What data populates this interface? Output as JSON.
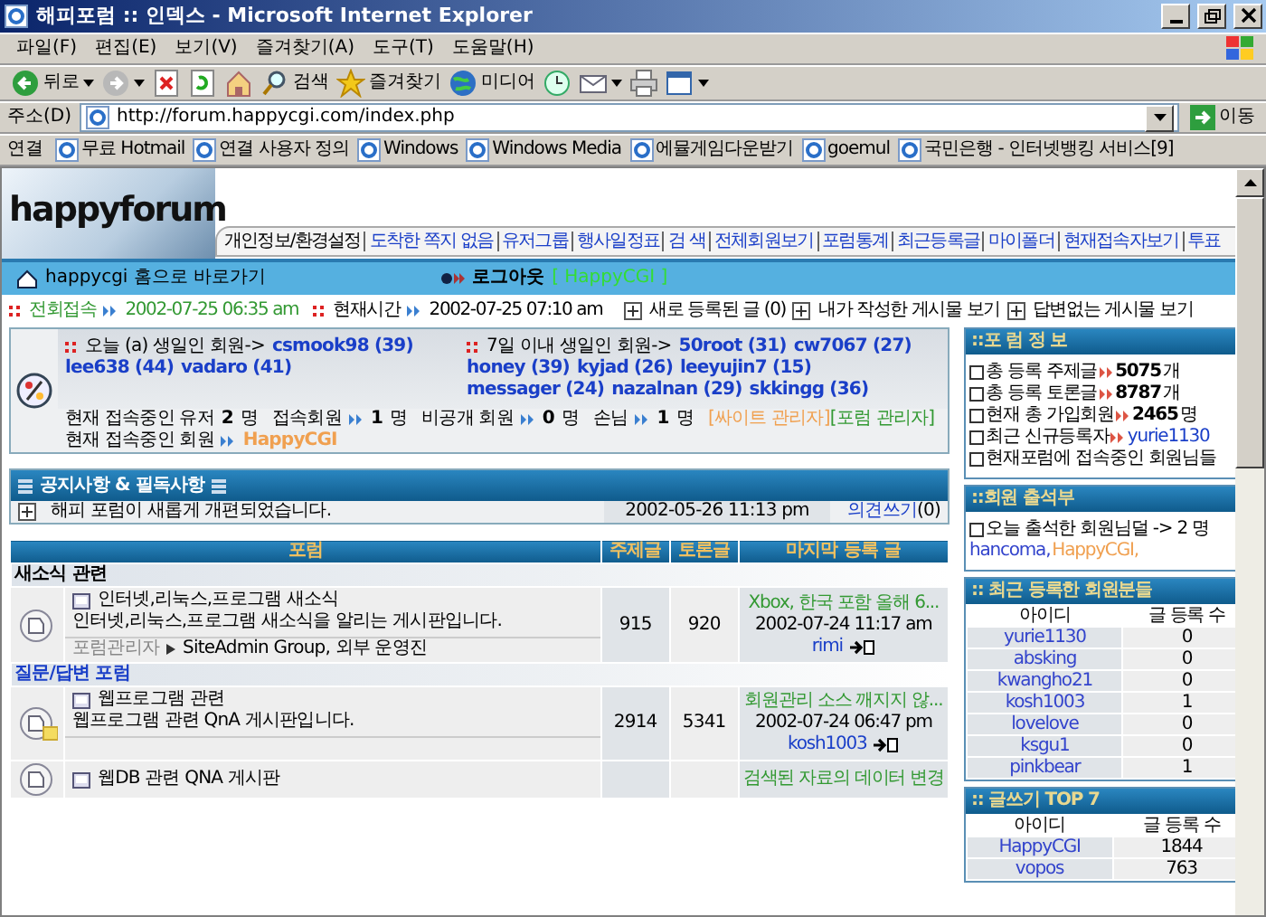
{
  "window": {
    "title": "해피포럼 :: 인덱스 - Microsoft Internet Explorer"
  },
  "menu": [
    "파일(F)",
    "편집(E)",
    "보기(V)",
    "즐겨찾기(A)",
    "도구(T)",
    "도움말(H)"
  ],
  "toolbar": [
    {
      "kind": "back",
      "label": "뒤로",
      "dropdown": true
    },
    {
      "kind": "forward",
      "dropdown": true
    },
    {
      "kind": "stop",
      "dropdown": false
    },
    {
      "kind": "refresh",
      "dropdown": false
    },
    {
      "kind": "home",
      "dropdown": false
    },
    {
      "kind": "search",
      "label": "검색",
      "dropdown": false
    },
    {
      "kind": "favorites",
      "label": "즐겨찾기",
      "dropdown": false
    },
    {
      "kind": "media",
      "label": "미디어",
      "dropdown": false
    },
    {
      "kind": "history",
      "dropdown": false
    },
    {
      "kind": "mail",
      "dropdown": true
    },
    {
      "kind": "print",
      "dropdown": false
    },
    {
      "kind": "edit",
      "dropdown": true
    }
  ],
  "address": {
    "label": "주소(D)",
    "url": "http://forum.happycgi.com/index.php",
    "go": "이동"
  },
  "links": {
    "label": "연결",
    "items": [
      "무료 Hotmail",
      "연결 사용자 정의",
      "Windows",
      "Windows Media",
      "에뮬게임다운받기",
      "goemul",
      "국민은행 - 인터넷뱅킹 서비스[9]"
    ]
  },
  "site": {
    "logo": "happyforum",
    "nav": [
      "개인정보/환경설정",
      "도착한 쪽지 없음",
      "유저그룹",
      "행사일정표",
      "검 색",
      "전체회원보기",
      "포럼통계",
      "최근등록글",
      "마이폴더",
      "현재접속자보기",
      "투표"
    ],
    "bar": {
      "home_link": "happycgi 홈으로 바로가기",
      "logout": "로그아웃",
      "user": "[ HappyCGI ]"
    }
  },
  "info": {
    "last_visit_label": "전회접속",
    "last_visit": "2002-07-25 06:35 am",
    "now_label": "현재시간",
    "now": "2002-07-25 07:10 am",
    "links": [
      "새로 등록된 글 (0)",
      "내가 작성한 게시물 보기",
      "답변없는 게시물 보기"
    ]
  },
  "birthday": {
    "today_label": "오늘 (a) 생일인 회원->",
    "today_members": [
      "csmook98 (39)",
      "lee638 (44)",
      "vadaro (41)"
    ],
    "week_label": "7일 이내 생일인 회원->",
    "week_members": [
      "50root (31)",
      "cw7067 (27)",
      "honey (39)",
      "kyjad (26)",
      "leeyujin7 (15)",
      "messager (24)",
      "nazalnan (29)",
      "skkingg (36)"
    ]
  },
  "online": {
    "stats": [
      {
        "label": "현재 접속중인 유저",
        "value": "2",
        "unit": "명",
        "arrow": false
      },
      {
        "label": "접속회원",
        "value": "1",
        "unit": "명",
        "arrow": true
      },
      {
        "label": "비공개 회원",
        "value": "0",
        "unit": "명",
        "arrow": true
      },
      {
        "label": "손님",
        "value": "1",
        "unit": "명",
        "arrow": true
      }
    ],
    "legend": [
      {
        "label": "[싸이트 관리자]",
        "color": "#f0a050"
      },
      {
        "label": "[포럼 관리자]",
        "color": "#339933"
      }
    ],
    "members_label": "현재 접속중인 회원",
    "members": [
      {
        "name": "HappyCGI",
        "color": "#f0a050"
      }
    ]
  },
  "notice": {
    "title": "공지사항 & 필독사항",
    "items": [
      {
        "text": "해피 포럼이 새롭게 개편되었습니다.",
        "date": "2002-05-26 11:13 pm",
        "comment": "의견쓰기",
        "count": "(0)"
      }
    ]
  },
  "forums": {
    "columns": [
      "포럼",
      "주제글",
      "토론글",
      "마지막 등록 글"
    ],
    "sections": [
      {
        "title": "새소식 관련",
        "color": "#000000",
        "forums": [
          {
            "title": "인터넷,리눅스,프로그램 새소식",
            "desc": "인터넷,리눅스,프로그램 새소식을 알리는 게시판입니다.",
            "moderators_label": "포럼관리자",
            "moderators": "SiteAdmin Group, 외부 운영진",
            "topics": "915",
            "posts": "920",
            "new_posts": false,
            "last": {
              "title": "Xbox, 한국 포함 올해 6...",
              "date": "2002-07-24 11:17 am",
              "user": "rimi"
            }
          }
        ]
      },
      {
        "title": "질문/답변 포럼",
        "color": "#1a3fc8",
        "forums": [
          {
            "title": "웹프로그램 관련",
            "desc": "웹프로그램 관련 QnA 게시판입니다.",
            "topics": "2914",
            "posts": "5341",
            "new_posts": true,
            "last": {
              "title": "회원관리 소스 깨지지 않...",
              "date": "2002-07-24 06:47 pm",
              "user": "kosh1003"
            }
          },
          {
            "title": "웹DB 관련 QNA 게시판",
            "new_posts": false,
            "last": {
              "title": "검색된 자료의 데이터 변경"
            }
          }
        ]
      }
    ]
  },
  "sidebar": {
    "forum_info": {
      "title": "::포 럼 정 보",
      "lines": [
        {
          "kind": "count",
          "label": "총 등록 주제글",
          "value": "5075",
          "unit": "개"
        },
        {
          "kind": "count",
          "label": "총 등록 토론글",
          "value": "8787",
          "unit": "개"
        },
        {
          "kind": "count",
          "label": "현재 총 가입회원",
          "value": "2465",
          "unit": "명"
        },
        {
          "kind": "user",
          "label": "최근 신규등록자",
          "value": "yurie1130"
        },
        {
          "kind": "text",
          "label": "현재포럼에 접속중인 회원님들"
        }
      ]
    },
    "attendance": {
      "title": "::회원 출석부",
      "text": "오늘 출석한 회원님덜 -> 2 명",
      "members": [
        {
          "name": "hancoma,",
          "color": "#3344cc"
        },
        {
          "name": "HappyCGI,",
          "color": "#f0a050"
        }
      ]
    },
    "recent": {
      "title": ":: 최근 등록한 회원분들",
      "columns": [
        "아이디",
        "글 등록 수"
      ],
      "rows": [
        [
          "yurie1130",
          "0"
        ],
        [
          "absking",
          "0"
        ],
        [
          "kwangho21",
          "0"
        ],
        [
          "kosh1003",
          "1"
        ],
        [
          "lovelove",
          "0"
        ],
        [
          "ksgu1",
          "0"
        ],
        [
          "pinkbear",
          "1"
        ]
      ]
    },
    "top": {
      "title": ":: 글쓰기 TOP 7",
      "columns": [
        "아이디",
        "글 등록 수"
      ],
      "rows": [
        [
          "HappyCGI",
          "1844"
        ],
        [
          "vopos",
          "763"
        ]
      ]
    }
  }
}
